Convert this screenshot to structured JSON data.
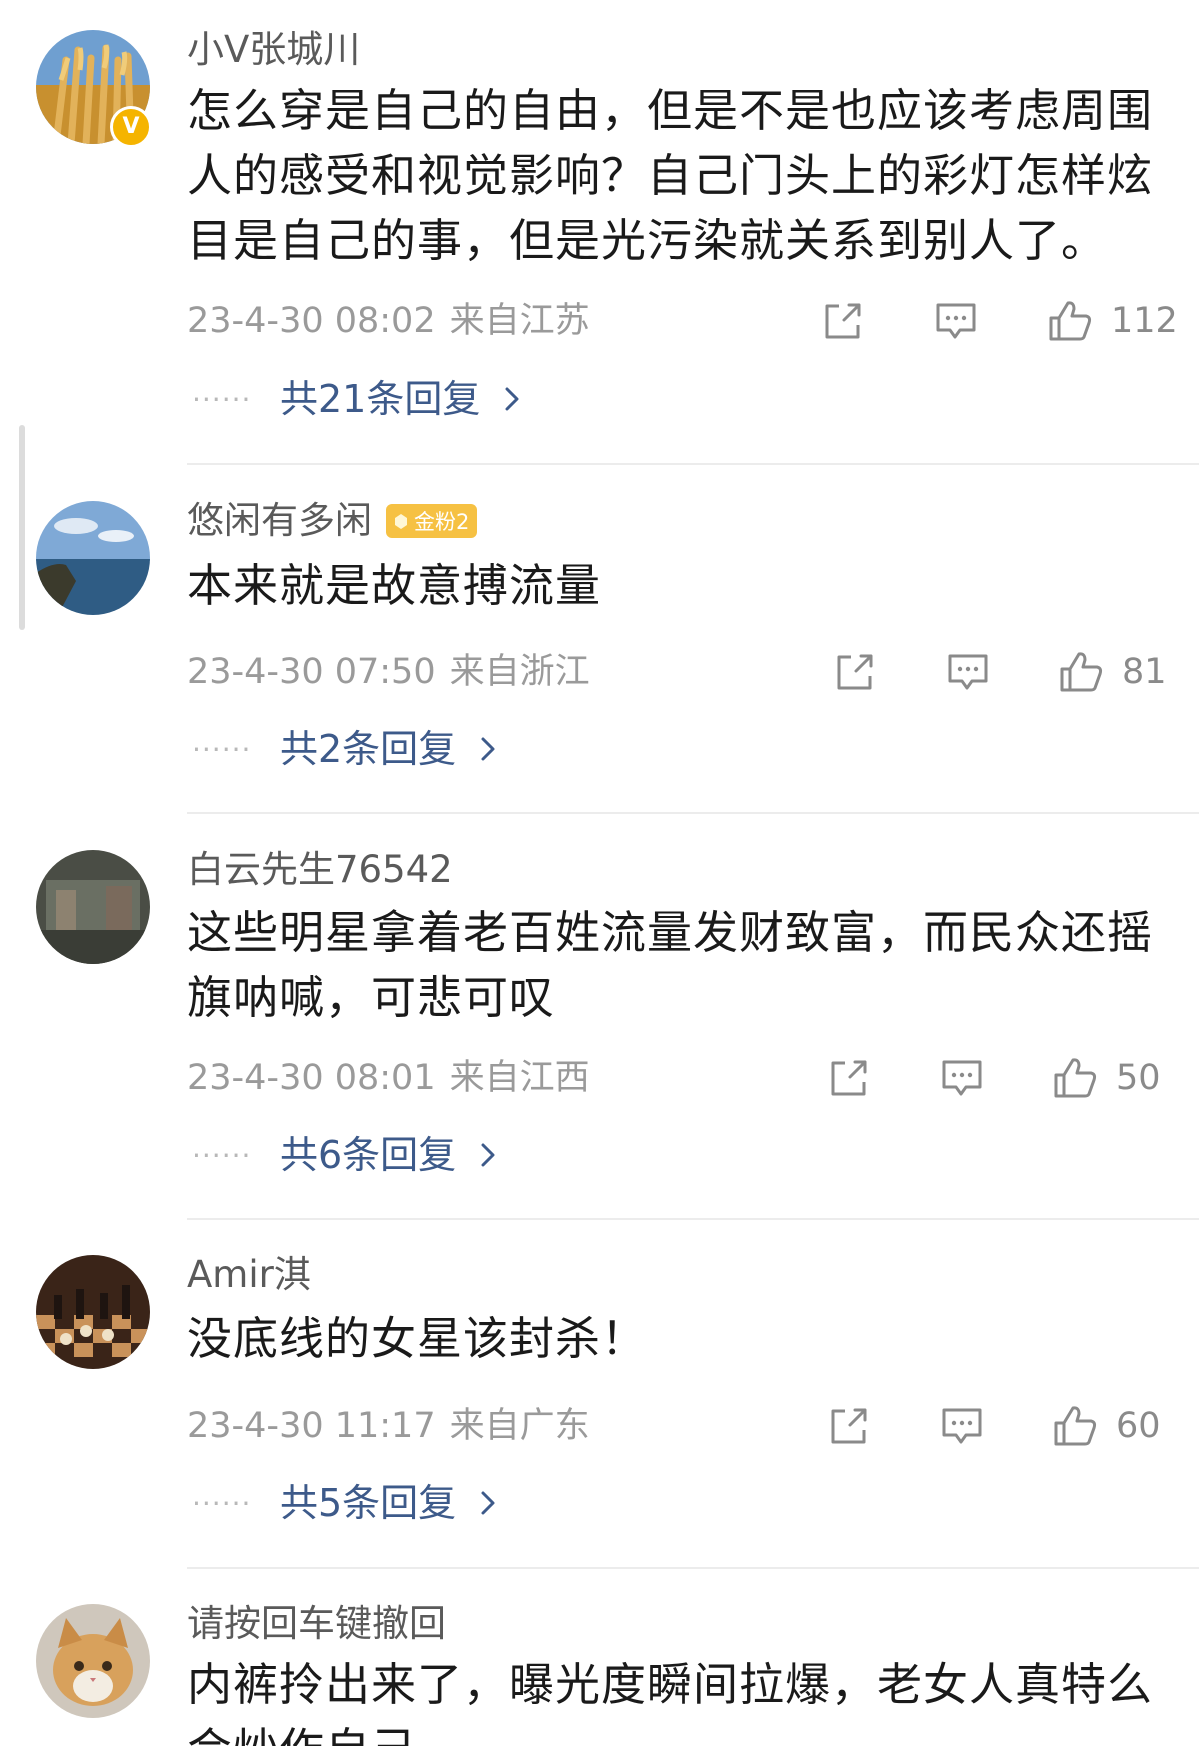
{
  "comments": [
    {
      "username": "小V张城川",
      "verified_badge": "V",
      "text": "怎么穿是自己的自由，但是不是也应该考虑周围人的感受和视觉影响？自己门头上的彩灯怎样炫目是自己的事，但是光污染就关系到别人了。",
      "time": "23-4-30 08:02",
      "location": "来自江苏",
      "likes": "112",
      "replies": "共21条回复"
    },
    {
      "username": "悠闲有多闲",
      "fan_badge": "金粉2",
      "text": "本来就是故意搏流量",
      "time": "23-4-30 07:50",
      "location": "来自浙江",
      "likes": "81",
      "replies": "共2条回复"
    },
    {
      "username": "白云先生76542",
      "text": "这些明星拿着老百姓流量发财致富，而民众还摇旗呐喊，可悲可叹",
      "time": "23-4-30 08:01",
      "location": "来自江西",
      "likes": "50",
      "replies": "共6条回复"
    },
    {
      "username": "Amir淇",
      "text": "没底线的女星该封杀！",
      "time": "23-4-30 11:17",
      "location": "来自广东",
      "likes": "60",
      "replies": "共5条回复"
    },
    {
      "username": "请按回车键撤回",
      "text": "内裤拎出来了，曝光度瞬间拉爆，老女人真特么会炒作自己"
    }
  ],
  "icons": {
    "share": "share-icon",
    "comment": "comment-icon",
    "like": "thumbs-up-icon",
    "more_replies": "chevron-right-icon"
  },
  "colors": {
    "username": "#5a5a5a",
    "text": "#1a1a1a",
    "meta": "#9a9a9a",
    "reply_link": "#3d5a8a",
    "fan_badge": "#f6c143",
    "verified_badge": "#f5b400"
  }
}
